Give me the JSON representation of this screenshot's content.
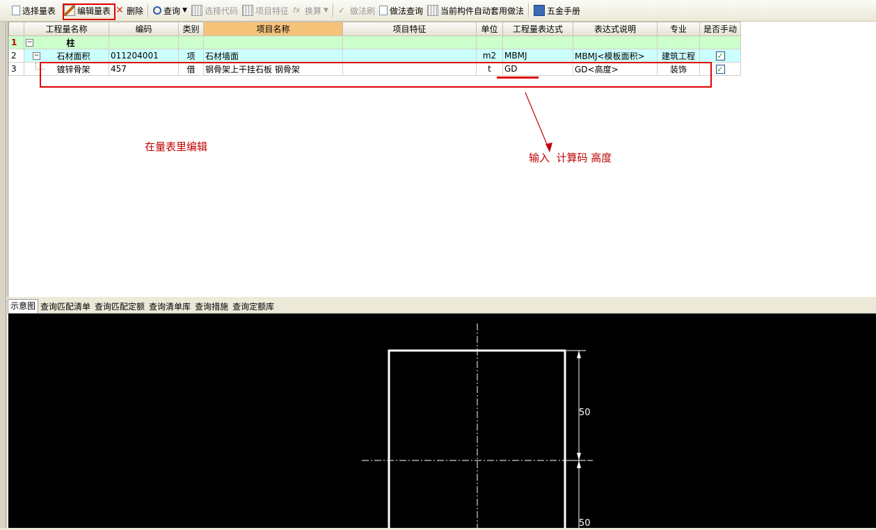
{
  "toolbar": {
    "items": [
      {
        "label": "选择量表",
        "icon": "select-table-icon"
      },
      {
        "label": "编辑量表",
        "icon": "edit-table-icon"
      },
      {
        "label": "删除",
        "icon": "delete-icon"
      },
      {
        "label": "查询",
        "icon": "search-icon"
      },
      {
        "label": "选择代码",
        "icon": "select-code-icon"
      },
      {
        "label": "项目特征",
        "icon": "item-feature-icon"
      },
      {
        "label": "换算",
        "icon": "formula-icon"
      },
      {
        "label": "做法刷",
        "icon": "brush-icon"
      },
      {
        "label": "做法查询",
        "icon": "method-query-icon"
      },
      {
        "label": "当前构件自动套用做法",
        "icon": "auto-apply-icon"
      },
      {
        "label": "五金手册",
        "icon": "manual-book-icon"
      }
    ]
  },
  "grid": {
    "columns": [
      "",
      "工程量名称",
      "编码",
      "类别",
      "项目名称",
      "项目特征",
      "单位",
      "工程量表达式",
      "表达式说明",
      "专业",
      "是否手动"
    ],
    "rows": [
      {
        "rn": "1",
        "name": "柱",
        "code": "",
        "type": "",
        "item": "",
        "feature": "",
        "unit": "",
        "expr": "",
        "expr_desc": "",
        "major": "",
        "manual": false
      },
      {
        "rn": "2",
        "name": "石材面积",
        "code": "011204001",
        "type": "项",
        "item": "石材墙面",
        "feature": "",
        "unit": "m2",
        "expr": "MBMJ",
        "expr_desc": "MBMJ<模板面积>",
        "major": "建筑工程",
        "manual": true
      },
      {
        "rn": "3",
        "name": "镀锌骨架",
        "code": "457",
        "type": "借",
        "item": "钢骨架上干挂石板 钢骨架",
        "feature": "",
        "unit": "t",
        "expr": "GD",
        "expr_desc": "GD<高度>",
        "major": "装饰",
        "manual": true
      }
    ]
  },
  "annotations": {
    "edit_note": "在量表里编辑",
    "input_note": "输入  计算码 高度"
  },
  "bottom_tabs": [
    "示意图",
    "查询匹配清单",
    "查询匹配定额",
    "查询清单库",
    "查询措施",
    "查询定额库"
  ],
  "diagram": {
    "dim_top": "50",
    "dim_bottom": "50"
  },
  "colors": {
    "highlight": "#e00000",
    "row_green": "#ccffcc",
    "row_cyan": "#ccffff",
    "active_header": "#f5c27a"
  }
}
